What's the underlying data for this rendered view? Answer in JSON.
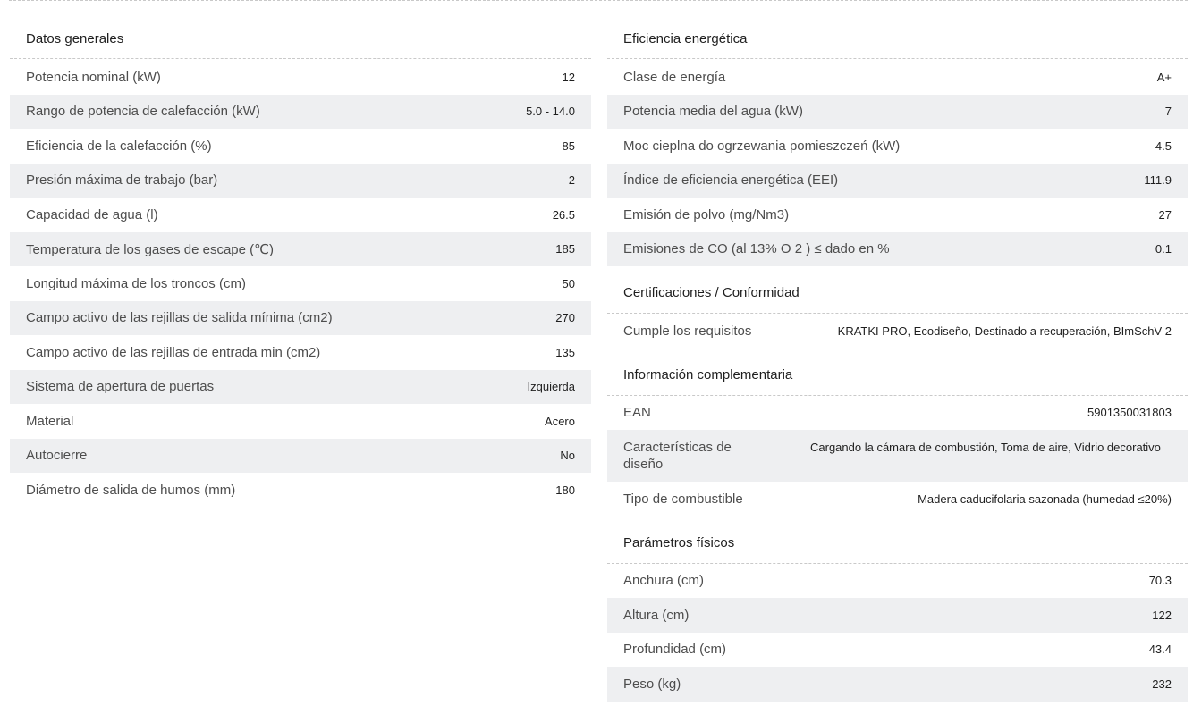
{
  "left": {
    "title": "Datos generales",
    "rows": [
      {
        "label": "Potencia nominal (kW)",
        "value": "12"
      },
      {
        "label": "Rango de potencia de calefacción (kW)",
        "value": "5.0 - 14.0"
      },
      {
        "label": "Eficiencia de la calefacción (%)",
        "value": "85"
      },
      {
        "label": "Presión máxima de trabajo (bar)",
        "value": "2"
      },
      {
        "label": "Capacidad de agua (l)",
        "value": "26.5"
      },
      {
        "label": "Temperatura de los gases de escape (℃)",
        "value": "185"
      },
      {
        "label": "Longitud máxima de los troncos (cm)",
        "value": "50"
      },
      {
        "label": "Campo activo de las rejillas de salida mínima (cm2)",
        "value": "270"
      },
      {
        "label": "Campo activo de las rejillas de entrada min (cm2)",
        "value": "135"
      },
      {
        "label": "Sistema de apertura de puertas",
        "value": "Izquierda"
      },
      {
        "label": "Material",
        "value": "Acero"
      },
      {
        "label": "Autocierre",
        "value": "No"
      },
      {
        "label": "Diámetro de salida de humos (mm)",
        "value": "180"
      }
    ]
  },
  "right": {
    "efficiency": {
      "title": "Eficiencia energética",
      "rows": [
        {
          "label": "Clase de energía",
          "value": "A+"
        },
        {
          "label": "Potencia media del agua (kW)",
          "value": "7"
        },
        {
          "label": "Moc cieplna do ogrzewania pomieszczeń (kW)",
          "value": "4.5"
        },
        {
          "label": "Índice de eficiencia energética (EEI)",
          "value": "111.9"
        },
        {
          "label": "Emisión de polvo (mg/Nm3)",
          "value": "27"
        },
        {
          "label": "Emisiones de CO (al 13% O 2 ) ≤ dado en %",
          "value": "0.1"
        }
      ]
    },
    "certifications": {
      "title": "Certificaciones / Conformidad",
      "rows": [
        {
          "label": "Cumple los requisitos",
          "value": "KRATKI PRO, Ecodiseño, Destinado a recuperación, BImSchV 2"
        }
      ]
    },
    "complementary": {
      "title": "Información complementaria",
      "rows": [
        {
          "label": "EAN",
          "value": "5901350031803"
        },
        {
          "label": "Características de diseño",
          "value": "Cargando la cámara de combustión, Toma de aire, Vidrio decorativo"
        },
        {
          "label": "Tipo de combustible",
          "value": "Madera caducifolaria sazonada (humedad ≤20%)"
        }
      ]
    },
    "physical": {
      "title": "Parámetros físicos",
      "rows": [
        {
          "label": "Anchura (cm)",
          "value": "70.3"
        },
        {
          "label": "Altura (cm)",
          "value": "122"
        },
        {
          "label": "Profundidad (cm)",
          "value": "43.4"
        },
        {
          "label": "Peso (kg)",
          "value": "232"
        }
      ]
    }
  },
  "colors": {
    "row_shade": "#eeeff1",
    "divider": "#c9c9c9"
  }
}
